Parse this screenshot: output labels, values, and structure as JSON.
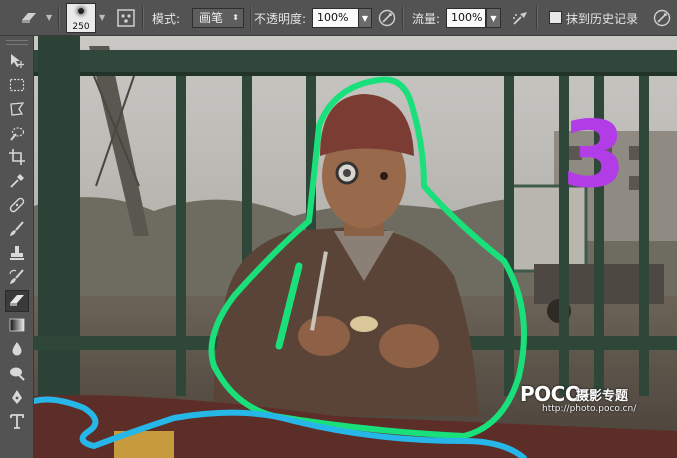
{
  "options_bar": {
    "brush_size": "250",
    "mode_label": "模式:",
    "mode_value": "画笔",
    "opacity_label": "不透明度:",
    "opacity_value": "100%",
    "flow_label": "流量:",
    "flow_value": "100%",
    "erase_history_label": "抹到历史记录",
    "erase_history_checked": false
  },
  "tools": [
    "move-icon",
    "marquee-icon",
    "lasso-icon",
    "quick-select-icon",
    "crop-icon",
    "eyedropper-icon",
    "healing-icon",
    "brush-icon",
    "stamp-icon",
    "history-brush-icon",
    "eraser-icon",
    "gradient-icon",
    "blur-icon",
    "dodge-icon",
    "pen-icon",
    "type-icon"
  ],
  "active_tool": "eraser-icon",
  "canvas": {
    "annotation_number": "3",
    "annotation_colors": {
      "green": "#19e07a",
      "cyan": "#27b6e8",
      "purple": "#b23ce6"
    }
  },
  "watermark": {
    "logo": "POCO",
    "title": "摄影专题",
    "url": "http://photo.poco.cn/"
  }
}
